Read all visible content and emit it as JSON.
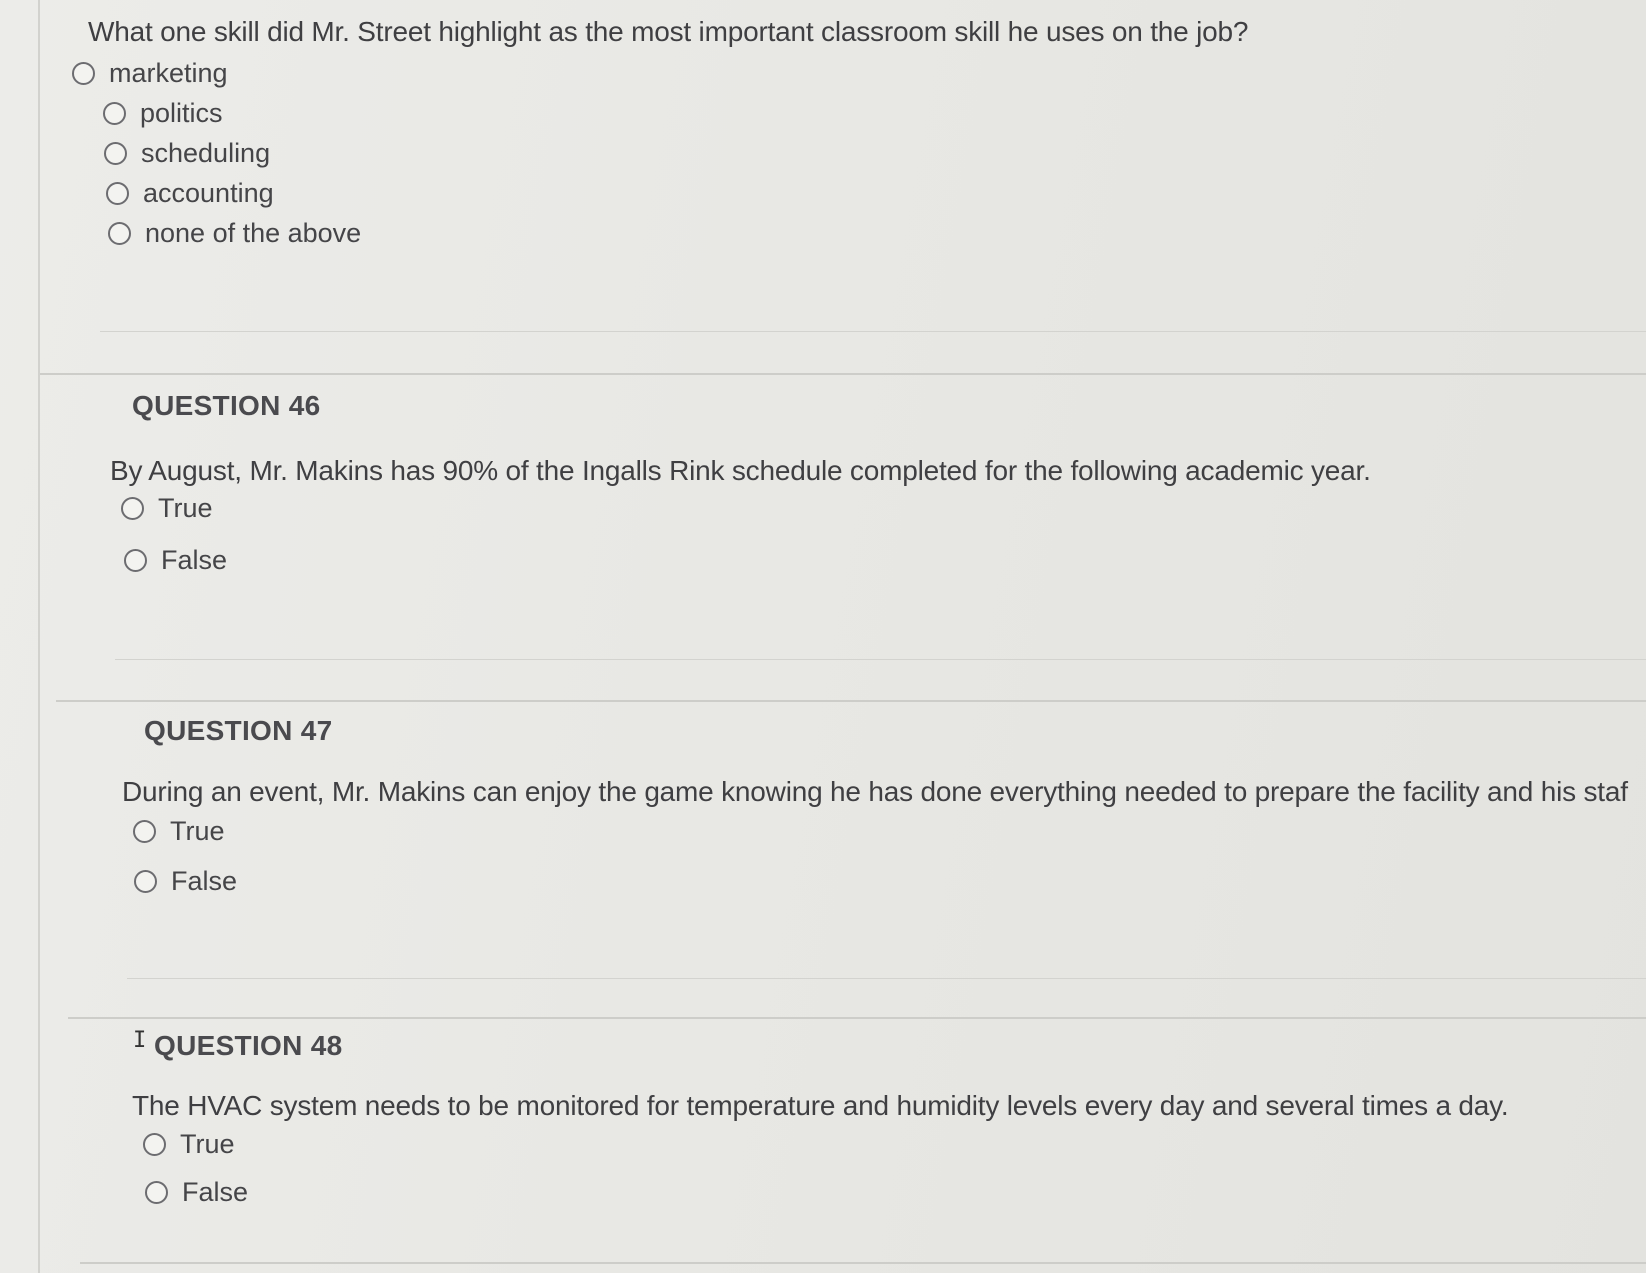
{
  "q45": {
    "text": "What one skill did Mr. Street highlight as the most important classroom skill he uses on the job?",
    "options": [
      "marketing",
      "politics",
      "scheduling",
      "accounting",
      "none of the above"
    ]
  },
  "q46": {
    "title": "QUESTION 46",
    "text": "By August, Mr. Makins has 90% of the Ingalls Rink schedule completed for the following academic year.",
    "options": [
      "True",
      "False"
    ]
  },
  "q47": {
    "title": "QUESTION 47",
    "text": "During an event, Mr. Makins can enjoy the game knowing he has done everything needed to prepare the facility and his staf",
    "options": [
      "True",
      "False"
    ]
  },
  "q48": {
    "title": "QUESTION 48",
    "text": "The HVAC system needs to be monitored for temperature and humidity levels every day and several times a day.",
    "options": [
      "True",
      "False"
    ]
  }
}
